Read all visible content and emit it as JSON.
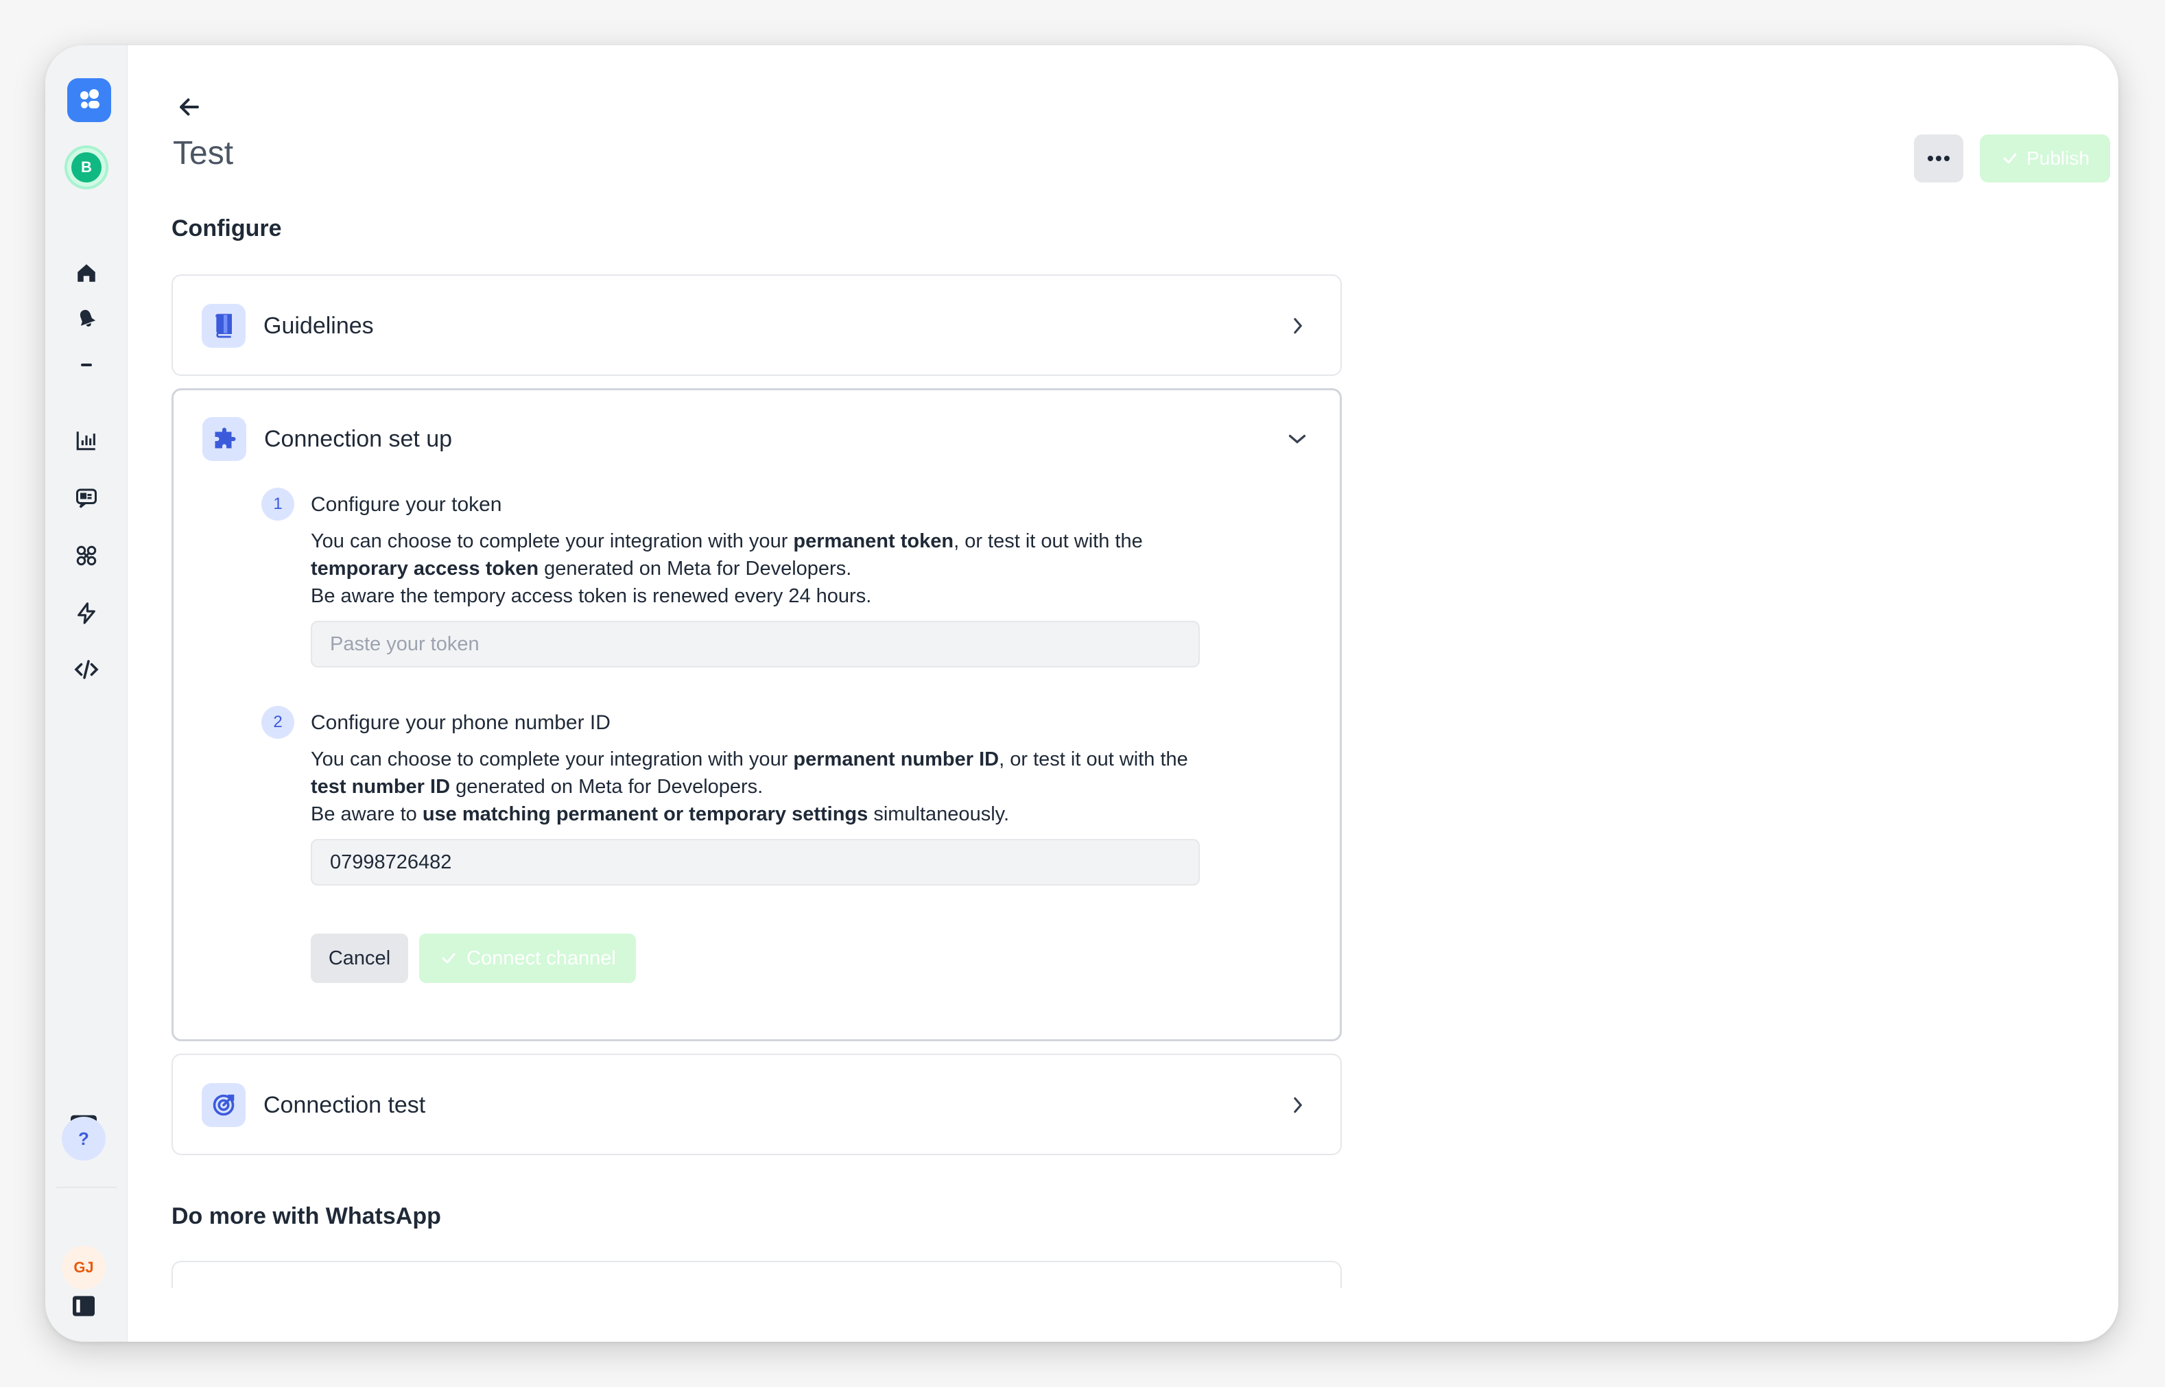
{
  "sidebar": {
    "workspace_initial": "B",
    "help_label": "?",
    "user_initials": "GJ",
    "icons": [
      "logo-icon",
      "home-icon",
      "notifications-icon",
      "collapse-icon",
      "analytics-icon",
      "inbox-icon",
      "integrations-icon",
      "automation-icon",
      "developer-icon",
      "terminal-icon",
      "help-icon",
      "panel-icon"
    ]
  },
  "header": {
    "title": "Test",
    "publish_label": "Publish"
  },
  "configure": {
    "heading": "Configure",
    "guidelines": {
      "title": "Guidelines"
    },
    "connection_setup": {
      "title": "Connection set up",
      "steps": [
        {
          "number": "1",
          "title": "Configure your token",
          "desc": {
            "p1": "You can choose to complete your integration with your ",
            "b1": "permanent token",
            "p2": ", or test it out with the ",
            "b2": "temporary access token",
            "p3": " generated on Meta for Developers.",
            "line2": "Be aware the tempory access token is renewed every 24 hours."
          },
          "input_placeholder": "Paste your token",
          "input_value": ""
        },
        {
          "number": "2",
          "title": "Configure your phone number ID",
          "desc": {
            "p1": "You can choose to complete your integration with your ",
            "b1": "permanent number ID",
            "p2": ", or test it out with the ",
            "b2": "test number ID",
            "p3": " generated on Meta for Developers.",
            "line2a": "Be aware to ",
            "line2b": "use matching permanent or temporary settings",
            "line2c": " simultaneously."
          },
          "input_placeholder": "",
          "input_value": "07998726482"
        }
      ],
      "cancel_label": "Cancel",
      "connect_label": "Connect channel"
    },
    "connection_test": {
      "title": "Connection test"
    }
  },
  "more": {
    "heading": "Do more with WhatsApp"
  },
  "colors": {
    "accent": "#3b82f6",
    "success_disabled": "#d3f9d8",
    "icon_bg": "#dbe4ff"
  }
}
